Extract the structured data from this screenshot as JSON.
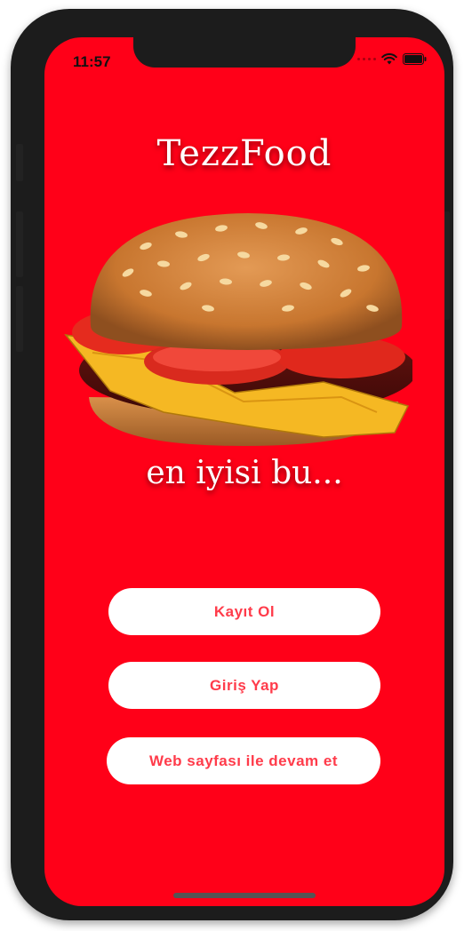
{
  "status_bar": {
    "time": "11:57",
    "icons": [
      "signal-dots",
      "wifi-icon",
      "battery-icon"
    ]
  },
  "app": {
    "title": "TezzFood",
    "slogan": "en iyisi bu..."
  },
  "buttons": {
    "register": "Kayıt Ol",
    "login": "Giriş Yap",
    "web": "Web sayfası ile devam et"
  },
  "colors": {
    "background": "#ff0018",
    "button_bg": "#ffffff",
    "button_text": "#ff3b4a"
  }
}
